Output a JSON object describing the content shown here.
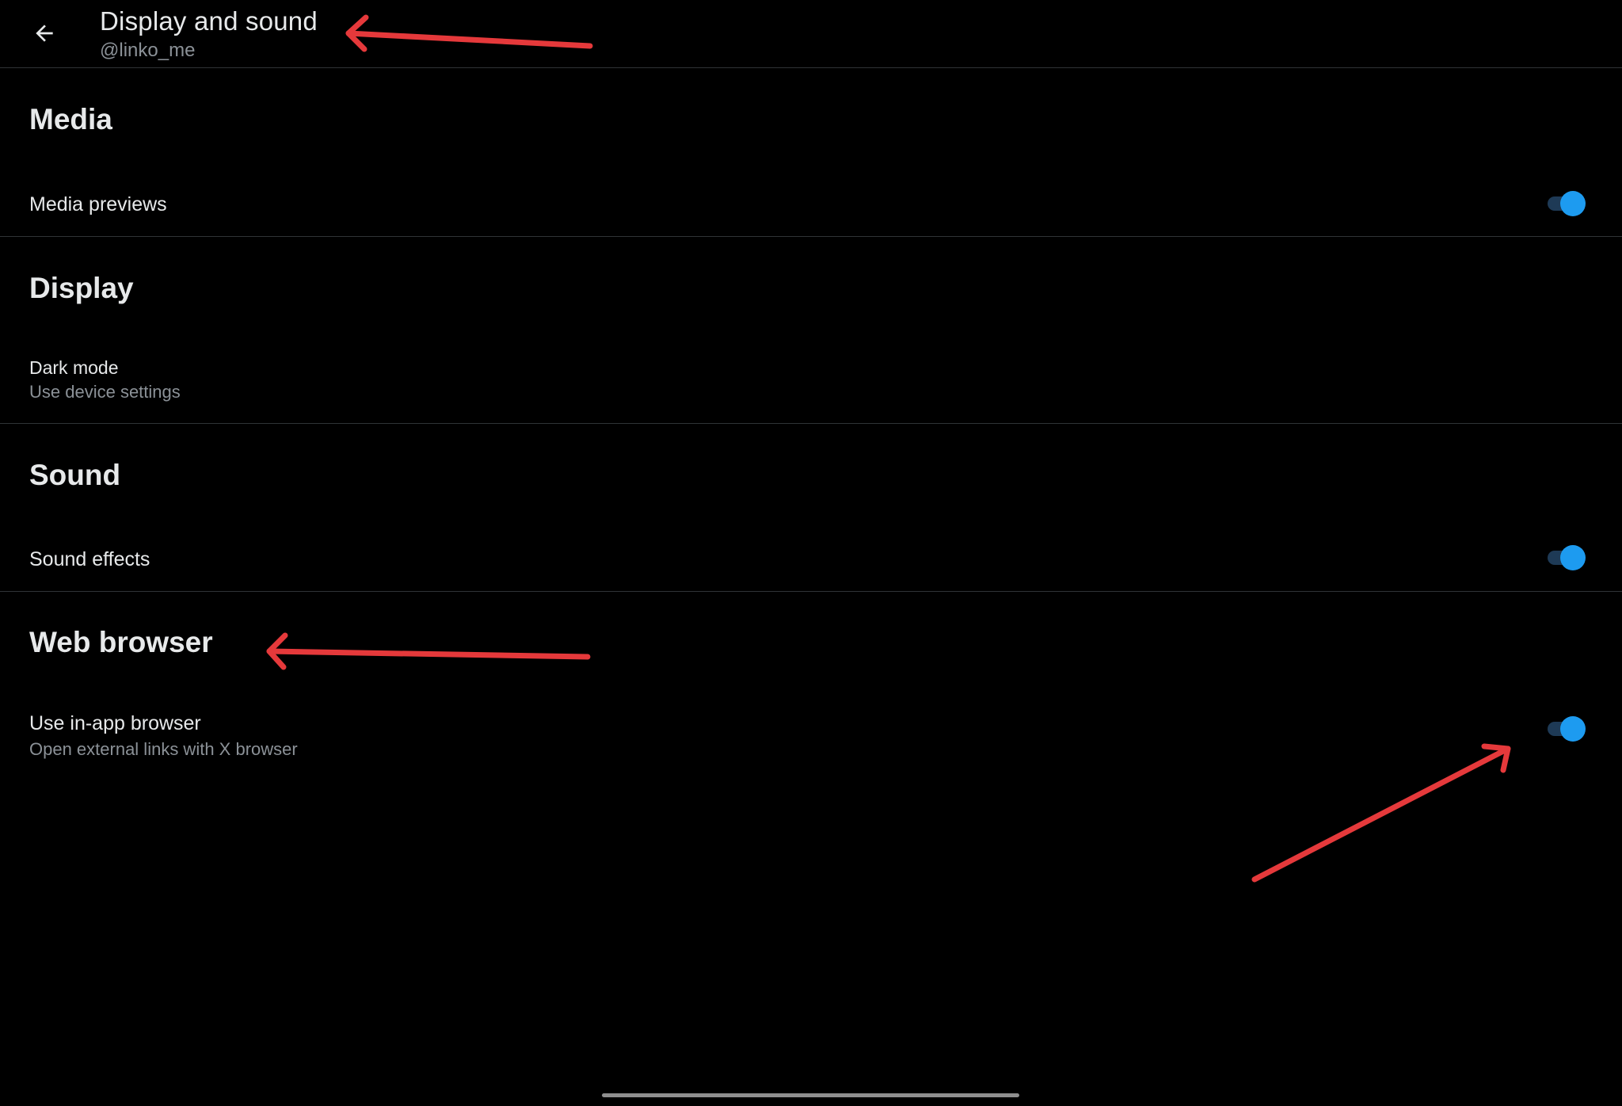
{
  "header": {
    "title": "Display and sound",
    "subtitle": "@linko_me",
    "back_icon": "arrow-left-icon"
  },
  "sections": [
    {
      "heading": "Media",
      "rows": [
        {
          "label": "Media previews",
          "toggle_on": true
        }
      ]
    },
    {
      "heading": "Display",
      "rows": [
        {
          "label": "Dark mode",
          "description": "Use device settings"
        }
      ]
    },
    {
      "heading": "Sound",
      "rows": [
        {
          "label": "Sound effects",
          "toggle_on": true
        }
      ]
    },
    {
      "heading": "Web browser",
      "rows": [
        {
          "label": "Use in-app browser",
          "description": "Open external links with X browser",
          "toggle_on": true
        }
      ]
    }
  ],
  "colors": {
    "background": "#000000",
    "text_primary": "#e7e9ea",
    "text_secondary": "#8b9197",
    "divider": "#2f3336",
    "toggle_knob": "#1d9bf0",
    "toggle_track": "#1e3a56",
    "annotation_arrow": "#e5393b"
  }
}
